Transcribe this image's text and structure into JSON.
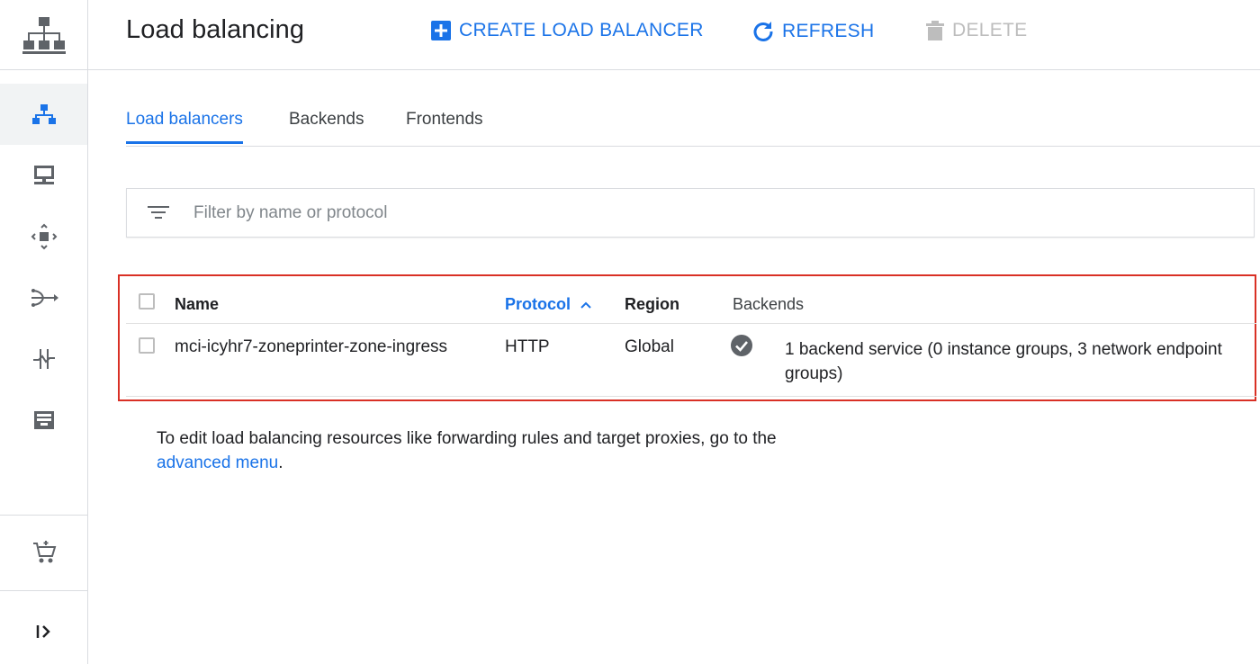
{
  "header": {
    "title": "Load balancing",
    "actions": [
      {
        "label": "CREATE LOAD BALANCER",
        "icon": "add-box-icon"
      },
      {
        "label": "REFRESH",
        "icon": "refresh-icon"
      },
      {
        "label": "DELETE",
        "icon": "trash-icon"
      }
    ]
  },
  "tabs": [
    {
      "label": "Load balancers",
      "active": true
    },
    {
      "label": "Backends",
      "active": false
    },
    {
      "label": "Frontends",
      "active": false
    }
  ],
  "filter": {
    "placeholder": "Filter by name or protocol",
    "icon": "filter-list-icon"
  },
  "table": {
    "columns": [
      "Name",
      "Protocol",
      "Region",
      "Backends"
    ],
    "sorted_column": "Protocol",
    "sort_direction": "ascending",
    "rows": [
      {
        "name": "mci-icyhr7-zoneprinter-zone-ingress",
        "protocol": "HTTP",
        "region": "Global",
        "backends_line1": "1 backend service (0 instance groups, 3 network endpoint",
        "backends_line2": "groups)",
        "status_icon": "check-circle-icon"
      }
    ]
  },
  "note": {
    "text": "To edit load balancing resources like forwarding rules and target proxies, go to the",
    "link": "advanced menu",
    "suffix": "."
  },
  "colors": {
    "accent": "#1a73e8",
    "highlight_border": "#d93025",
    "disabled": "#bdbdbd"
  }
}
